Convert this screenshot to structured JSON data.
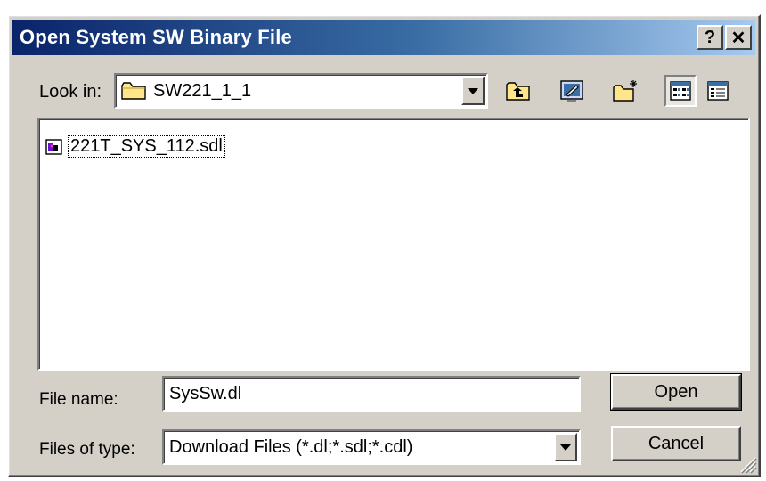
{
  "window": {
    "title": "Open System SW Binary File",
    "help_label": "?",
    "close_label": "✕"
  },
  "lookin": {
    "label": "Look in:",
    "value": "SW221_1_1"
  },
  "toolbar": {
    "icons": [
      "up-folder-icon",
      "desktop-icon",
      "new-folder-icon",
      "list-view-icon",
      "details-view-icon"
    ]
  },
  "files": [
    {
      "name": "221T_SYS_112.sdl",
      "icon": "sdl-file-icon"
    }
  ],
  "filename": {
    "label": "File name:",
    "value": "SysSw.dl"
  },
  "filetype": {
    "label": "Files of type:",
    "value": "Download Files (*.dl;*.sdl;*.cdl)"
  },
  "buttons": {
    "open": "Open",
    "cancel": "Cancel"
  },
  "colors": {
    "title_gradient_start": "#0a246a",
    "title_gradient_end": "#a6caf0",
    "face": "#d4d0c8"
  }
}
